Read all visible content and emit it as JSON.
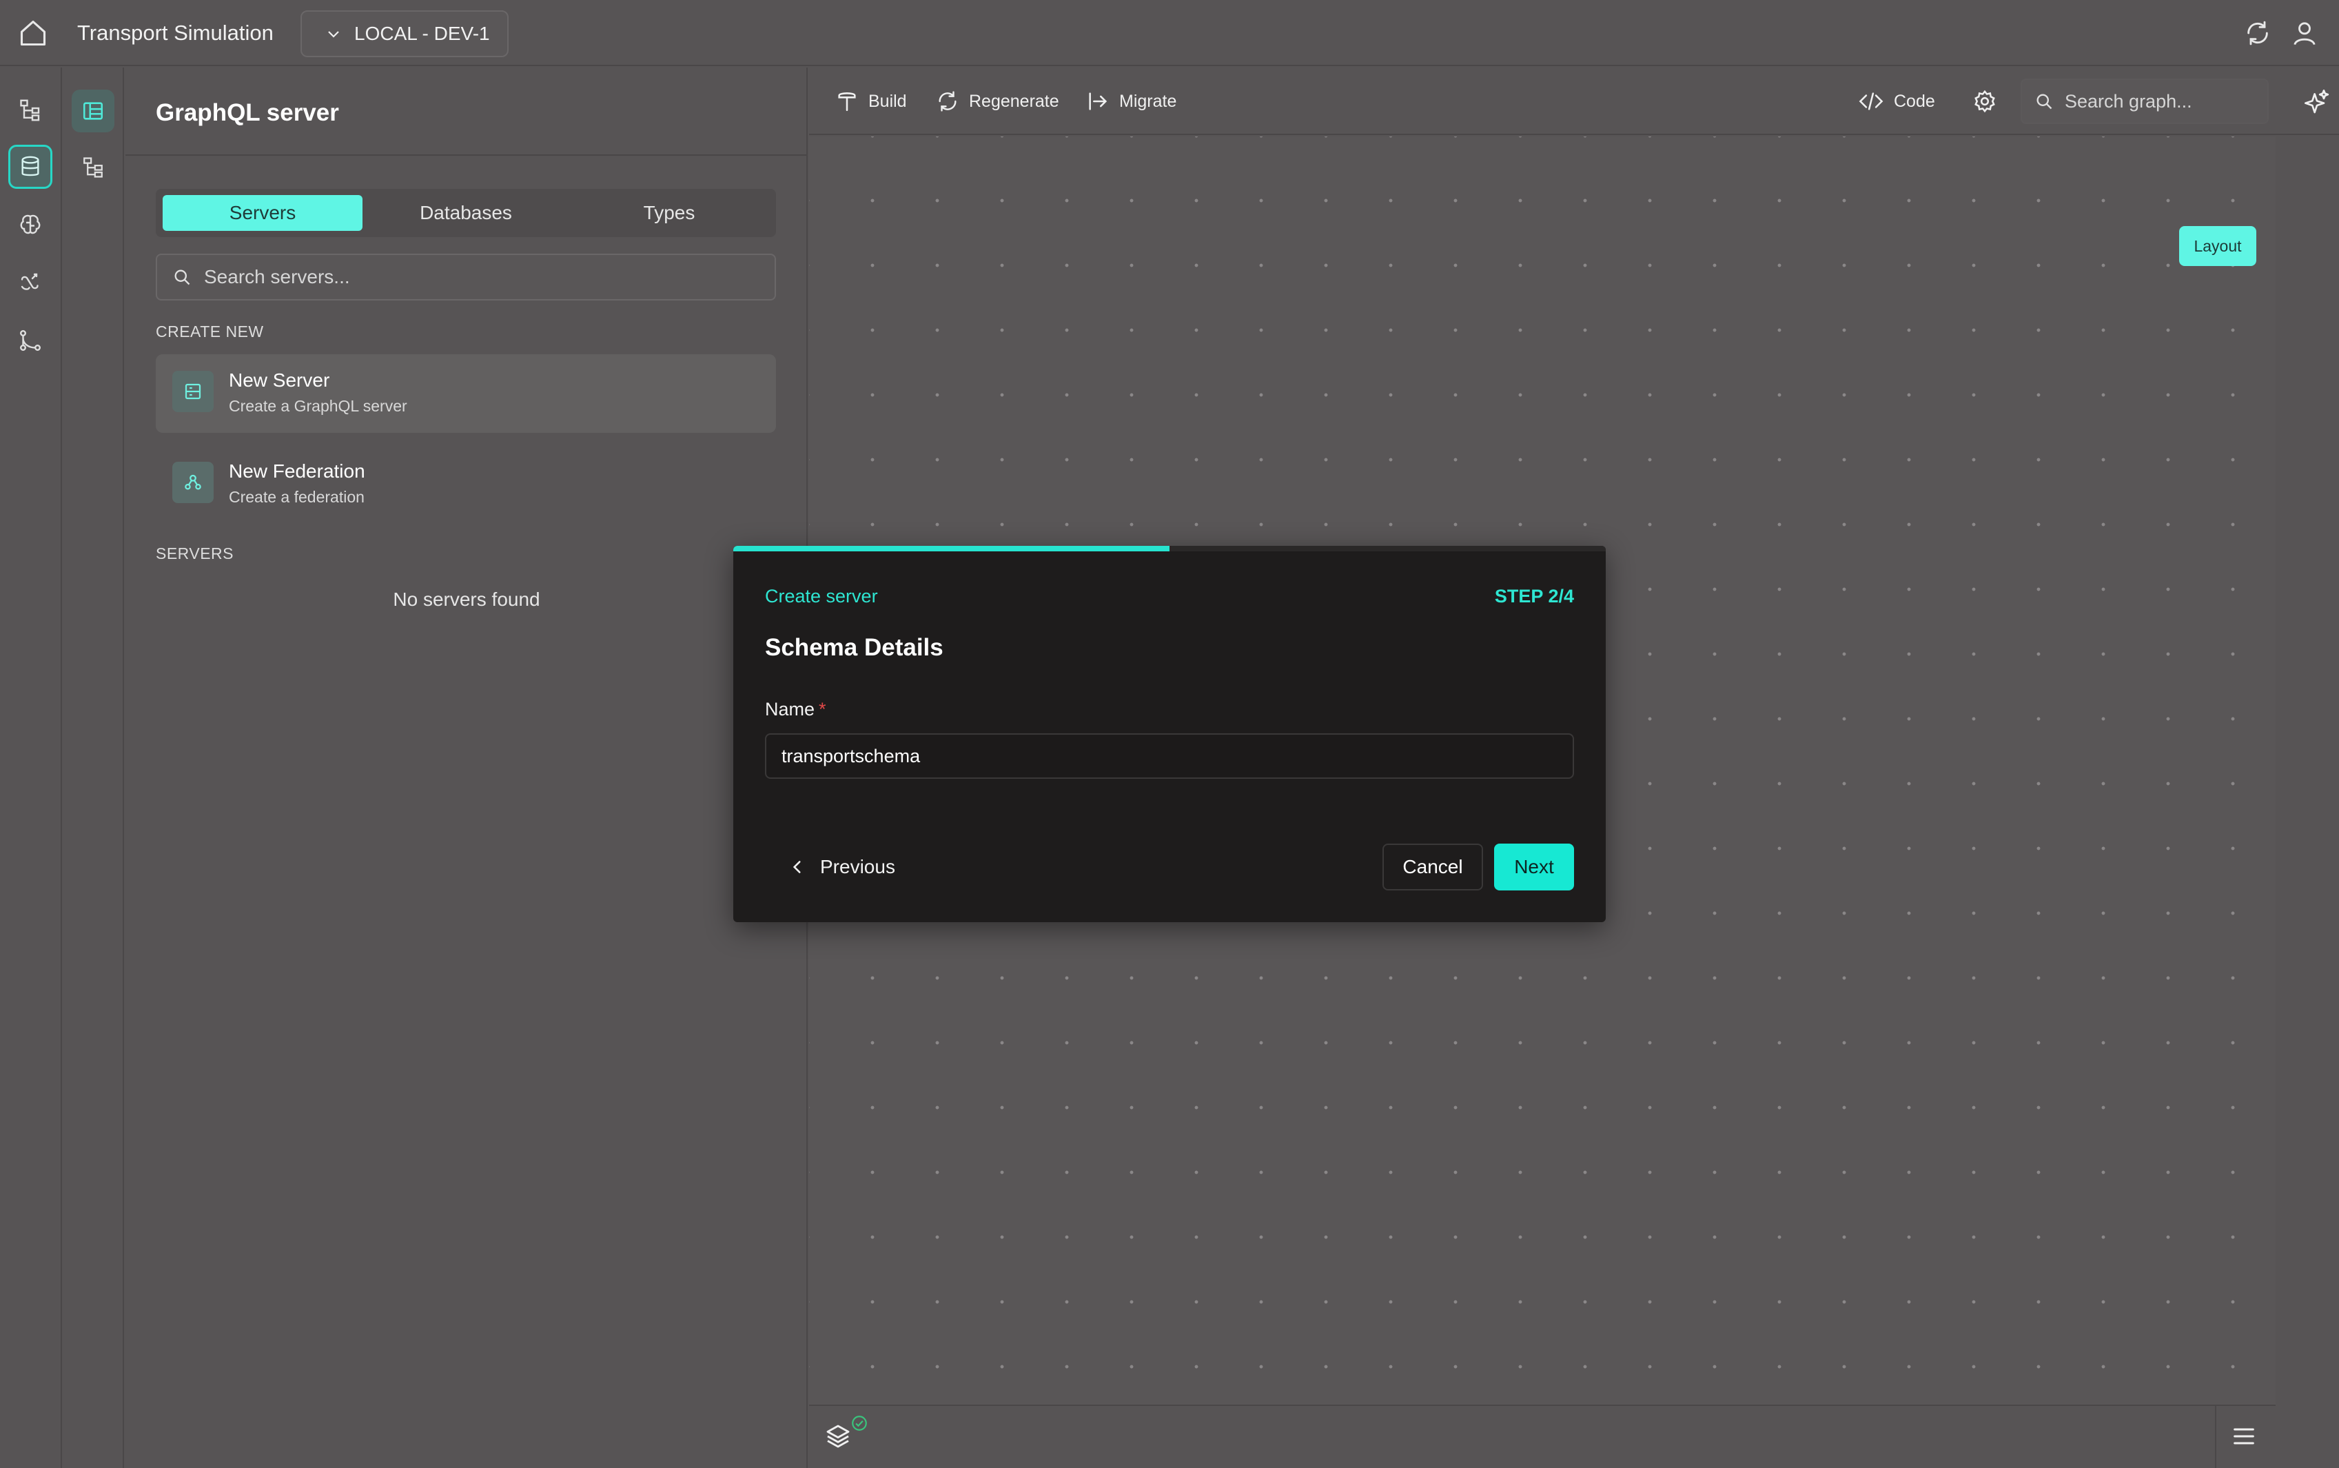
{
  "topbar": {
    "app_title": "Transport Simulation",
    "environment": "LOCAL - DEV-1"
  },
  "rail_icons": [
    "tree-structure-icon",
    "database-icon",
    "brain-icon",
    "function-icon",
    "git-branch-icon"
  ],
  "panel": {
    "title": "GraphQL server",
    "tabs": [
      {
        "label": "Servers",
        "active": true
      },
      {
        "label": "Databases",
        "active": false
      },
      {
        "label": "Types",
        "active": false
      }
    ],
    "search_placeholder": "Search servers...",
    "create_new_heading": "CREATE NEW",
    "create_items": [
      {
        "title": "New Server",
        "subtitle": "Create a GraphQL server"
      },
      {
        "title": "New Federation",
        "subtitle": "Create a federation"
      }
    ],
    "servers_heading": "SERVERS",
    "empty_text": "No servers found"
  },
  "toolbar": {
    "build_label": "Build",
    "regenerate_label": "Regenerate",
    "migrate_label": "Migrate",
    "code_label": "Code",
    "search_placeholder": "Search graph..."
  },
  "canvas": {
    "layout_label": "Layout"
  },
  "modal": {
    "kicker": "Create server",
    "step": "STEP 2/4",
    "progress_fraction": 0.5,
    "title": "Schema Details",
    "field_label": "Name",
    "required_mark": "*",
    "field_value": "transportschema",
    "previous_label": "Previous",
    "cancel_label": "Cancel",
    "next_label": "Next"
  },
  "colors": {
    "accent": "#27e3cf",
    "background": "#575455",
    "modal_bg": "#1e1c1c"
  }
}
